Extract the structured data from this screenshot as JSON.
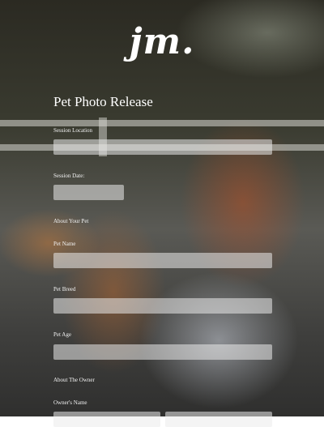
{
  "brand": {
    "logo_text": "jm."
  },
  "form": {
    "title": "Pet Photo Release",
    "session_location": {
      "label": "Session Location",
      "value": ""
    },
    "session_date": {
      "label": "Session Date:",
      "value": ""
    },
    "about_pet": {
      "heading": "About Your Pet"
    },
    "pet_name": {
      "label": "Pet Name",
      "value": ""
    },
    "pet_breed": {
      "label": "Pet Breed",
      "value": ""
    },
    "pet_age": {
      "label": "Pet Age",
      "value": ""
    },
    "about_owner": {
      "heading": "About The Owner"
    },
    "owners_name": {
      "label": "Owner's Name",
      "first_value": "",
      "last_value": ""
    }
  }
}
